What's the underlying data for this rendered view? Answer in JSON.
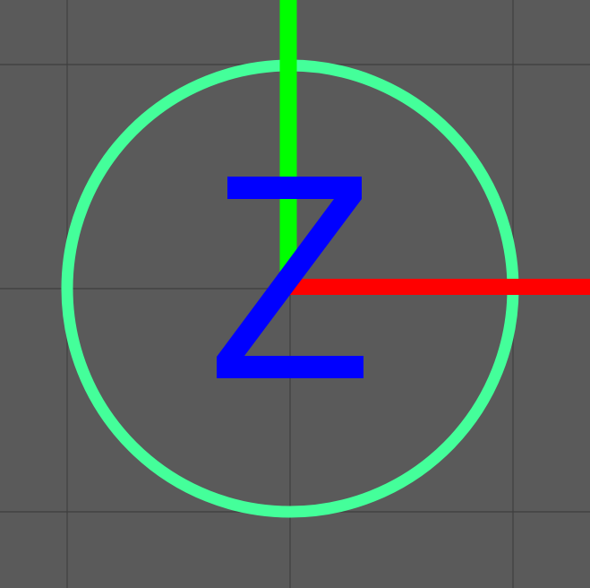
{
  "viewport": {
    "background_color": "#5a5a5a",
    "grid_color": "#3f3f3f",
    "grid_visible": true
  },
  "gizmo": {
    "axis_y_color": "#00ff00",
    "axis_x_color": "#ff0000",
    "ring_color": "#44ff9a",
    "axis_label": "Z",
    "axis_label_color": "#0000ff"
  }
}
